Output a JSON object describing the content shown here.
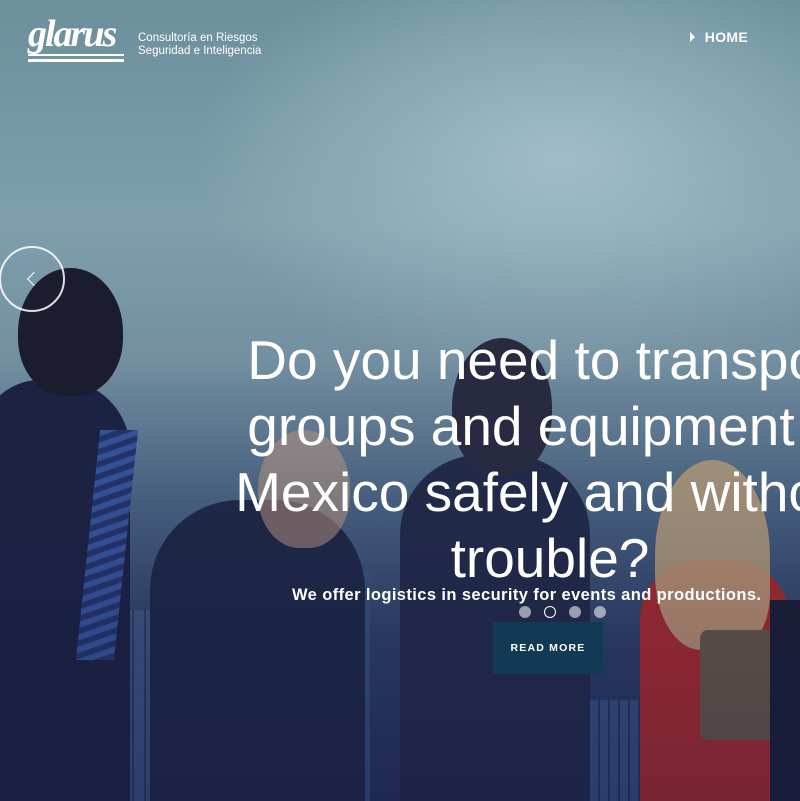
{
  "header": {
    "logo_text": "glarus",
    "tagline_line1": "Consultoría en Riesgos",
    "tagline_line2": "Seguridad e Inteligencia"
  },
  "nav": {
    "items": [
      {
        "label": "HOME"
      }
    ]
  },
  "slider": {
    "headline_lines": [
      "Do you need to transport",
      "groups and equipment in",
      "Mexico safely and without",
      "trouble?"
    ],
    "subtext": "We offer logistics in security for events and productions.",
    "cta_label": "READ MORE",
    "dots_count": 4,
    "active_dot": 2,
    "prev_arrow_icon": "chevron-left-icon"
  },
  "colors": {
    "cta_background": "#123a55",
    "text": "#ffffff"
  }
}
